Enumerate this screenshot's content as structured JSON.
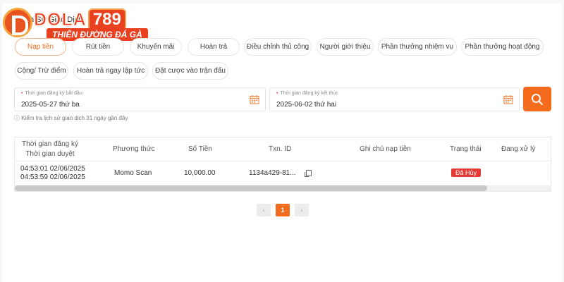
{
  "brand": {
    "name": "DOLA",
    "number": "789",
    "tagline": "THIÊN ĐƯỜNG ĐÁ GÀ"
  },
  "page": {
    "title": "Lịch Sử Giao Dịch"
  },
  "tabs": [
    {
      "label": "Nạp tiền",
      "active": true
    },
    {
      "label": "Rút tiền"
    },
    {
      "label": "Khuyến mãi"
    },
    {
      "label": "Hoàn trả"
    },
    {
      "label": "Điều chỉnh thủ công"
    },
    {
      "label": "Người giới thiệu"
    },
    {
      "label": "Phần thưởng nhiệm vụ"
    },
    {
      "label": "Phần thưởng hoạt động"
    },
    {
      "label": "Cộng/ Trừ điểm"
    },
    {
      "label": "Hoàn trả ngay lập tức"
    },
    {
      "label": "Đặt cược vào trận đấu"
    }
  ],
  "filters": {
    "start": {
      "label": "Thời gian đăng ký bắt đầu",
      "value": "2025-05-27 thứ ba"
    },
    "end": {
      "label": "Thời gian đăng ký kết thúc",
      "value": "2025-06-02 thứ hai"
    },
    "hint": "ⓘ Kiểm tra lịch sử giao dịch 31 ngày gần đây"
  },
  "table": {
    "headers": {
      "time_line1": "Thời gian đăng ký",
      "time_line2": "Thời gian duyệt",
      "method": "Phương thức",
      "amount": "Số Tiền",
      "txn": "Txn. ID",
      "note": "Ghi chú nạp tiền",
      "status": "Trạng thái",
      "processing": "Đang xử lý"
    },
    "rows": [
      {
        "reg_time": "04:53:01 02/06/2025",
        "approve_time": "04:53:59 02/06/2025",
        "method": "Momo Scan",
        "amount": "10,000.00",
        "txn": "1134a429-81...",
        "note": "",
        "status": "Đã Hủy",
        "processing": ""
      }
    ]
  },
  "pagination": {
    "prev": "‹",
    "current": "1",
    "next": "›"
  },
  "colors": {
    "accent": "#f46b1e",
    "status_cancelled": "#e53935"
  }
}
